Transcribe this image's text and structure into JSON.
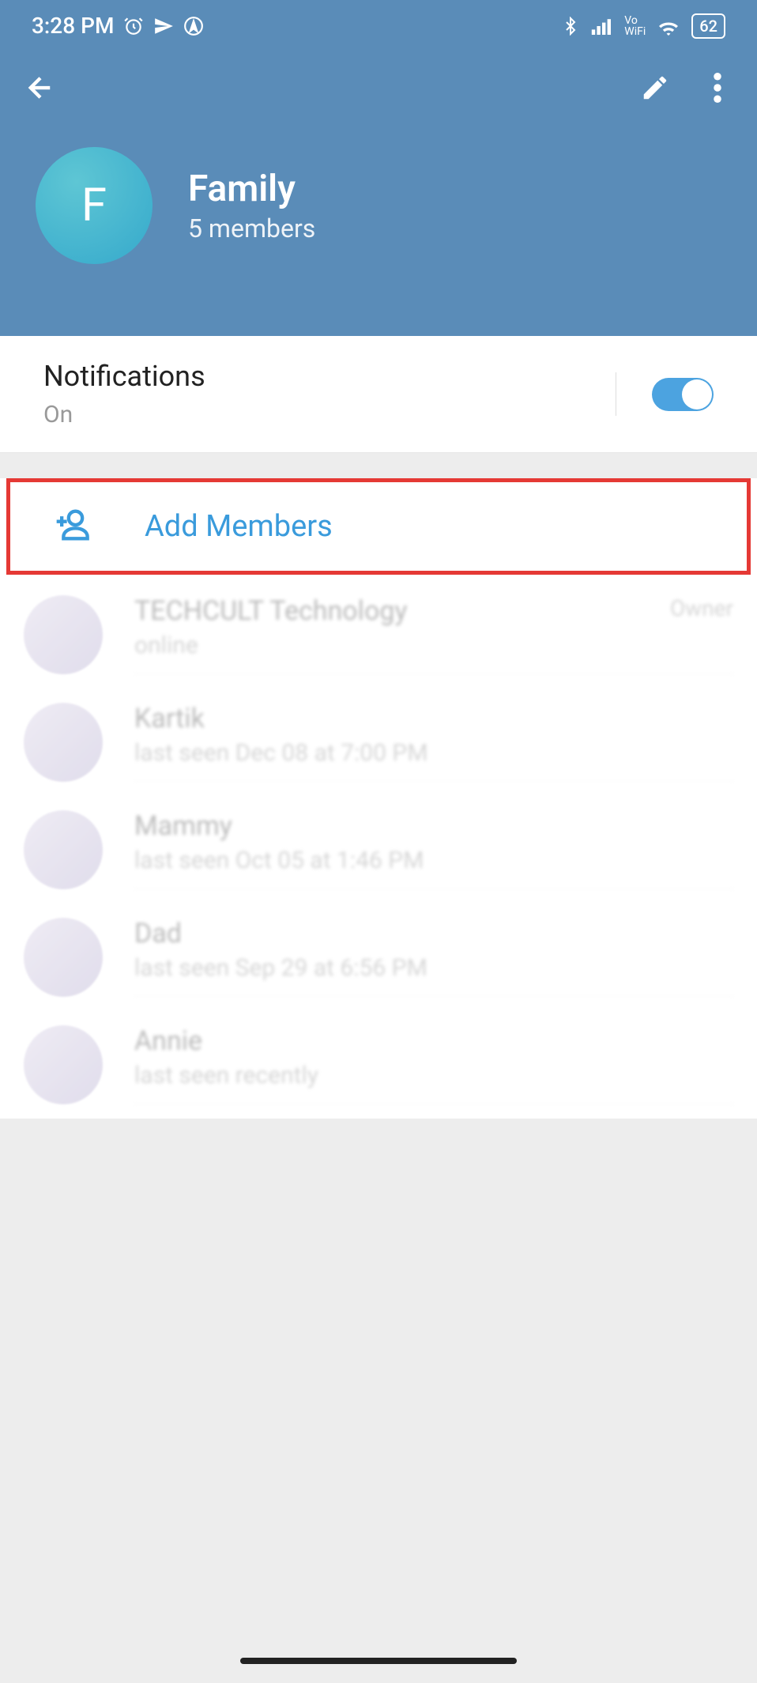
{
  "status_bar": {
    "time": "3:28 PM",
    "battery": "62"
  },
  "header": {
    "group_initial": "F",
    "group_name": "Family",
    "member_count": "5 members"
  },
  "notifications": {
    "title": "Notifications",
    "status": "On"
  },
  "add_members_label": "Add Members",
  "members": [
    {
      "name": "TECHCULT Technology",
      "status": "online",
      "role": "Owner"
    },
    {
      "name": "Kartik",
      "status": "last seen Dec 08 at 7:00 PM",
      "role": ""
    },
    {
      "name": "Mammy",
      "status": "last seen Oct 05 at 1:46 PM",
      "role": ""
    },
    {
      "name": "Dad",
      "status": "last seen Sep 29 at 6:56 PM",
      "role": ""
    },
    {
      "name": "Annie",
      "status": "last seen recently",
      "role": ""
    }
  ]
}
